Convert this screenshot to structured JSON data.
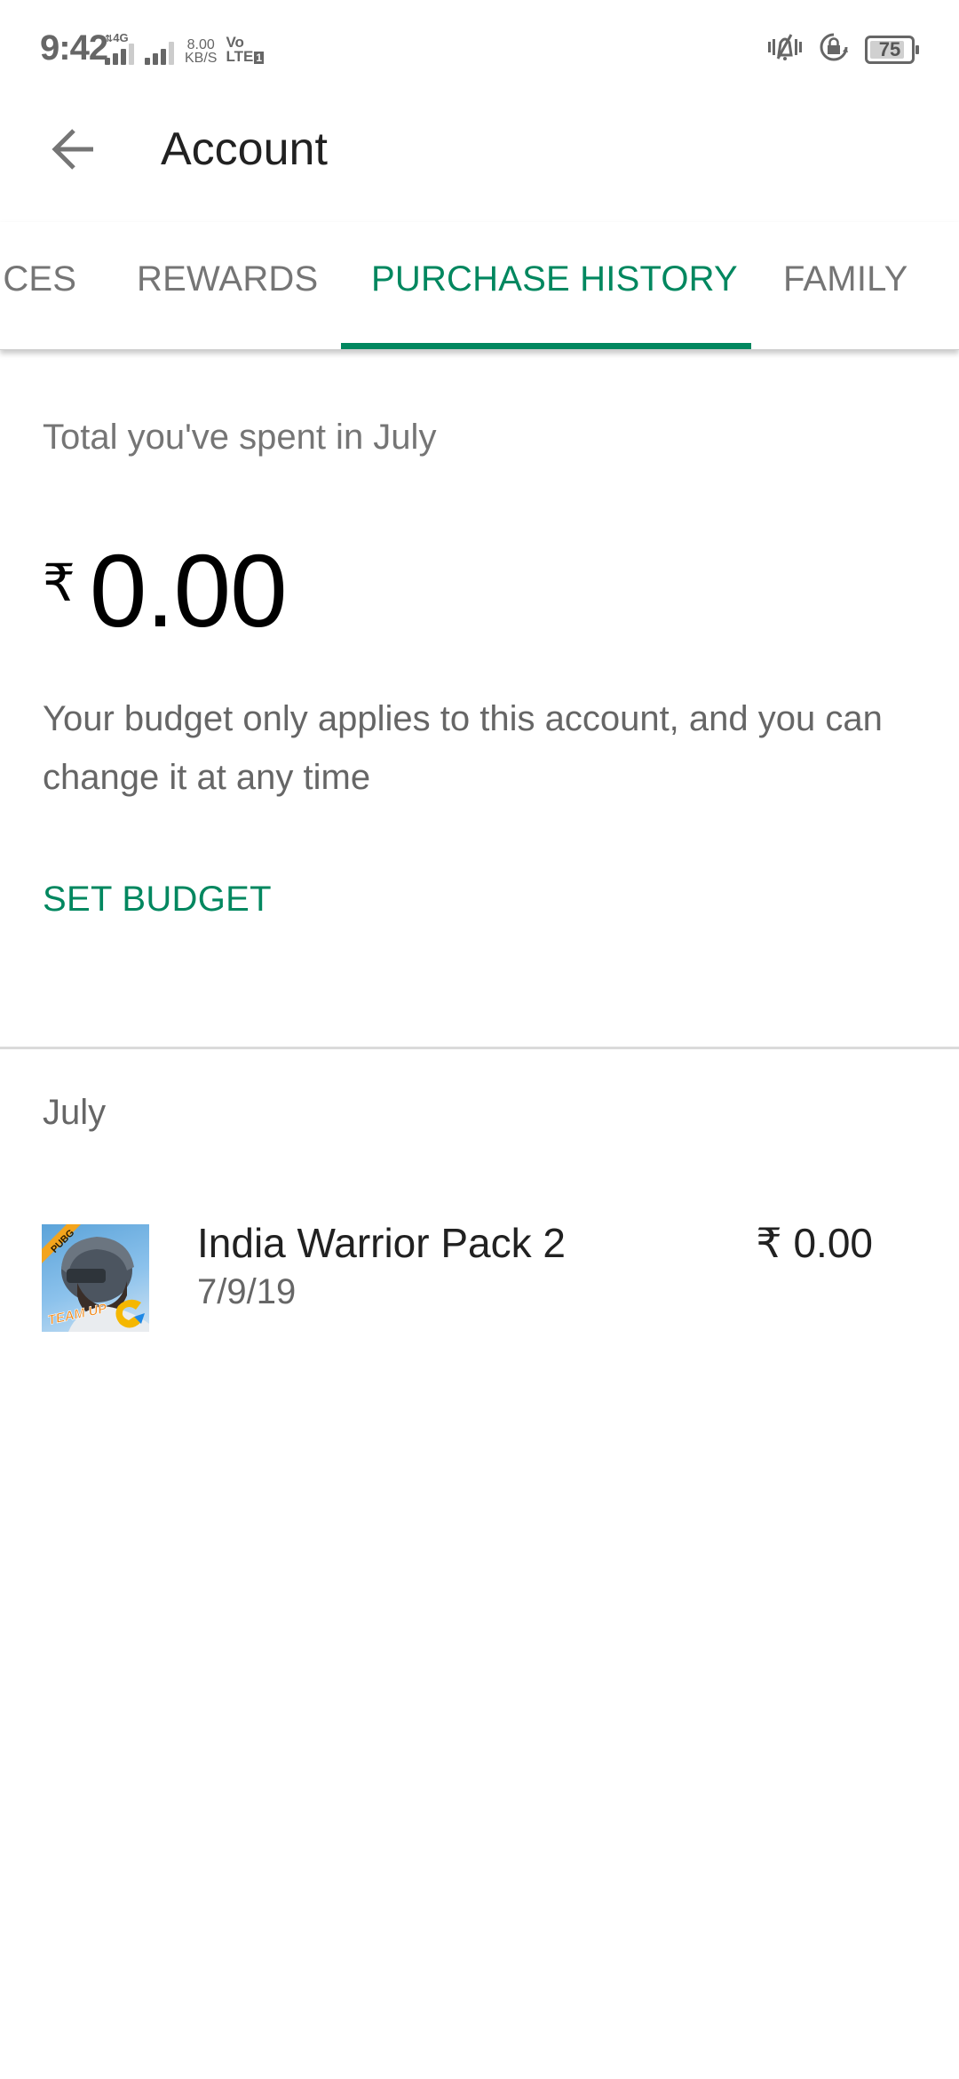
{
  "status_bar": {
    "time": "9:42",
    "network_type": "4G",
    "speed_value": "8.00",
    "speed_unit": "KB/S",
    "volte_top": "Vo",
    "volte_bottom": "LTE",
    "sim_slot": "1",
    "battery_level": "75",
    "icons": [
      "data-activity-icon",
      "signal-sim1-icon",
      "signal-sim2-icon",
      "vibrate-mute-icon",
      "rotation-lock-icon",
      "battery-icon"
    ]
  },
  "toolbar": {
    "back_icon": "arrow-left-icon",
    "title": "Account"
  },
  "tabs": [
    {
      "label": "ICES",
      "active": false
    },
    {
      "label": "REWARDS",
      "active": false
    },
    {
      "label": "PURCHASE HISTORY",
      "active": true
    },
    {
      "label": "FAMILY",
      "active": false
    }
  ],
  "summary": {
    "spent_label": "Total you've spent in July",
    "currency_symbol": "₹",
    "amount": "0.00",
    "budget_note": "Your budget only applies to this account, and you can change it at any time",
    "set_budget_label": "SET BUDGET"
  },
  "history": {
    "month": "July",
    "items": [
      {
        "title": "India Warrior Pack 2",
        "date": "7/9/19",
        "price": "₹ 0.00",
        "icon": "pubg-mobile-app-icon",
        "icon_badge": "PUBG",
        "icon_caption": "TEAM UP"
      }
    ]
  },
  "colors": {
    "accent": "#01875f",
    "text_primary": "#212121",
    "text_secondary": "#757575",
    "divider": "#dadada"
  }
}
